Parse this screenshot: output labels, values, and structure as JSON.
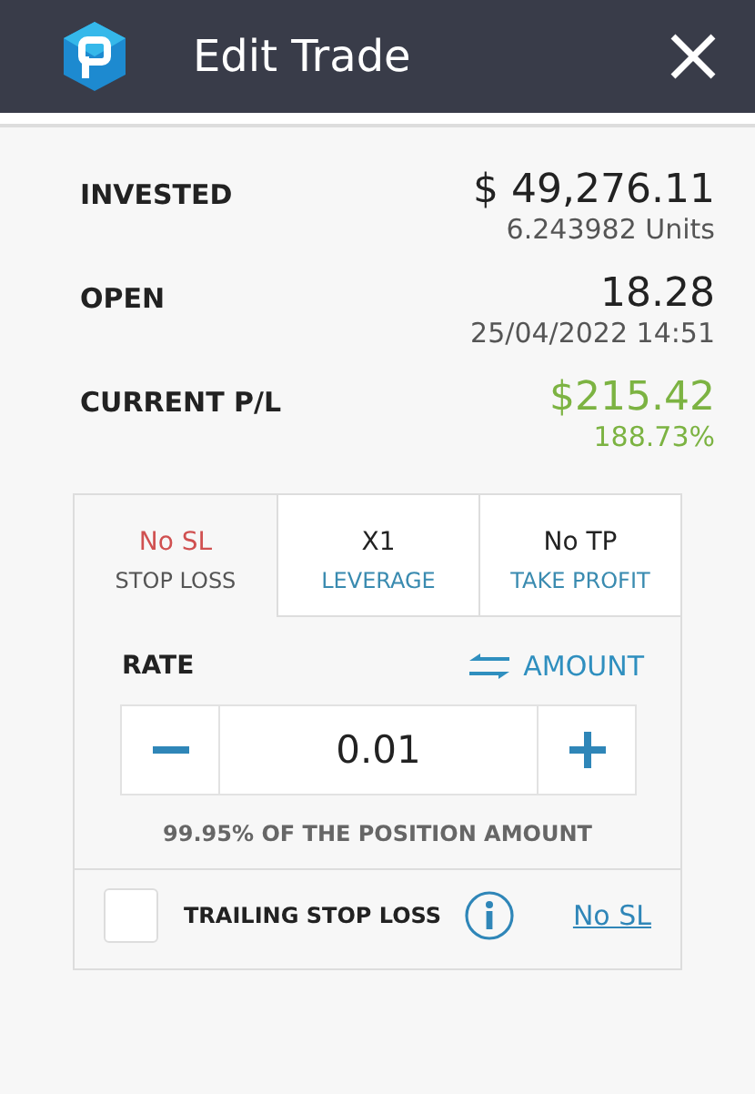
{
  "window": {
    "title": "Edit Trade"
  },
  "summary": [
    {
      "label": "INVESTED",
      "value": "$ 49,276.11",
      "detail": "6.243982 Units",
      "kind": "plain"
    },
    {
      "label": "OPEN",
      "value": "18.28",
      "detail": "25/04/2022 14:51",
      "kind": "plain"
    },
    {
      "label": "CURRENT P/L",
      "value": "$215.42",
      "detail": "188.73%",
      "kind": "profit"
    }
  ],
  "tabs": [
    {
      "value": "No SL",
      "label": "STOP LOSS",
      "selected": true
    },
    {
      "value": "X1",
      "label": "LEVERAGE",
      "selected": false
    },
    {
      "value": "No TP",
      "label": "TAKE PROFIT",
      "selected": false
    }
  ],
  "rate": {
    "label": "RATE",
    "toggle": "AMOUNT",
    "value": "0.01",
    "note": "99.95% OF THE POSITION AMOUNT"
  },
  "trailing": {
    "label": "TRAILING STOP LOSS",
    "checked": false,
    "link": "No SL"
  }
}
